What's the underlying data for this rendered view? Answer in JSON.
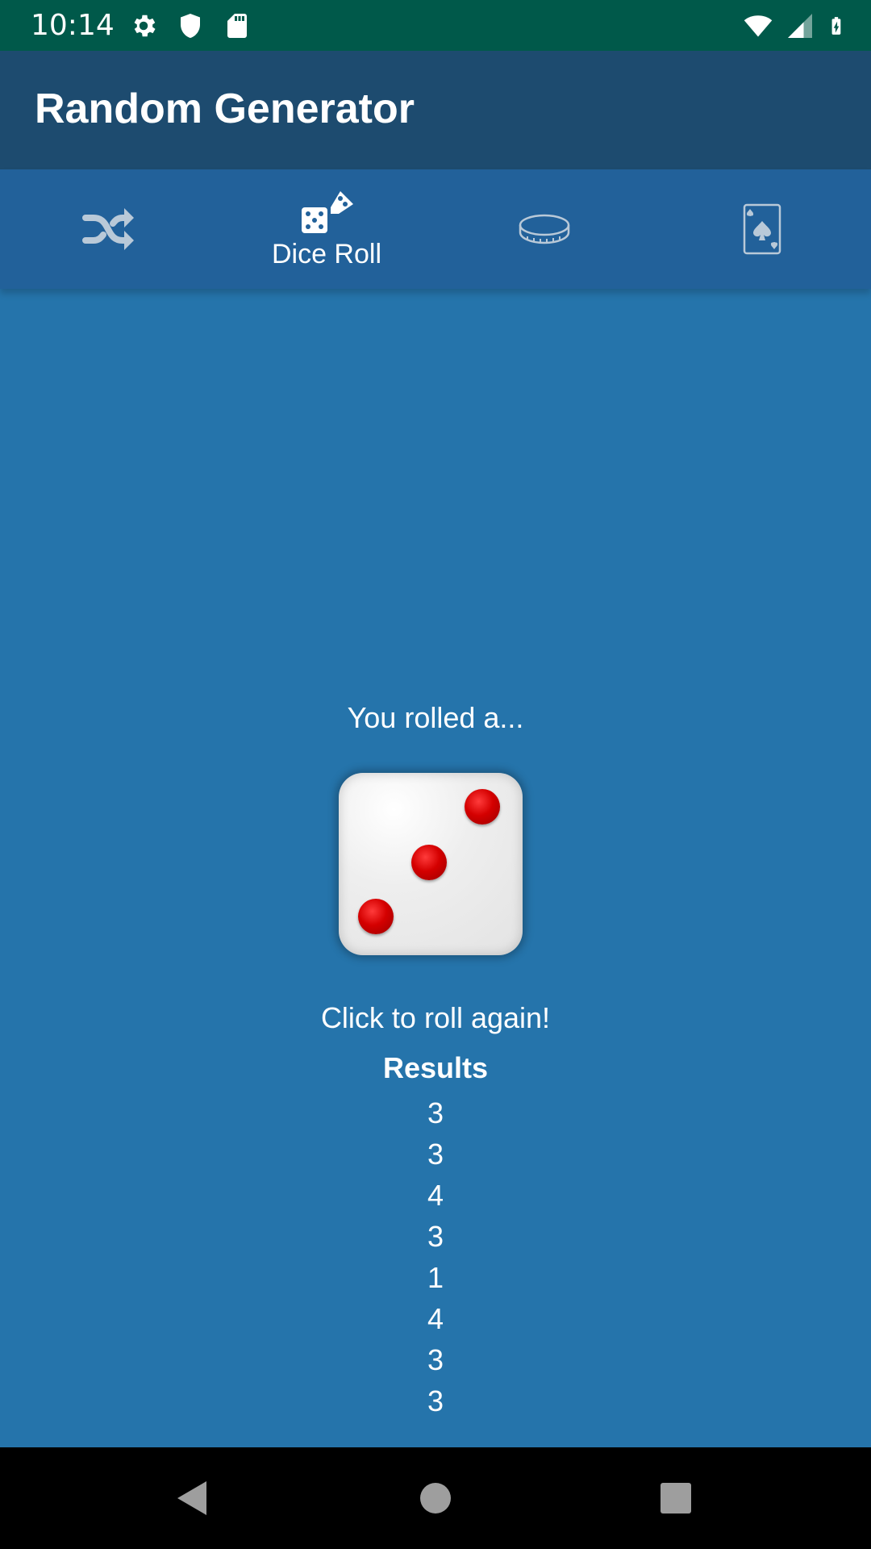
{
  "status_bar": {
    "time": "10:14",
    "left_icons": [
      "gear-icon",
      "shield-icon",
      "sd-card-icon"
    ],
    "right_icons": [
      "wifi-icon",
      "cell-signal-icon",
      "battery-charging-icon"
    ]
  },
  "app_bar": {
    "title": "Random Generator",
    "color": "#1d4b6f"
  },
  "tabs": [
    {
      "icon": "shuffle-icon",
      "label": "",
      "selected": false
    },
    {
      "icon": "dice-icon",
      "label": "Dice Roll",
      "selected": true
    },
    {
      "icon": "coin-icon",
      "label": "",
      "selected": false
    },
    {
      "icon": "playing-card-icon",
      "label": "",
      "selected": false
    }
  ],
  "main": {
    "rolled_text": "You rolled a...",
    "die_value": 3,
    "roll_again_text": "Click to roll again!",
    "results_title": "Results",
    "results": [
      "3",
      "3",
      "4",
      "3",
      "1",
      "4",
      "3",
      "3"
    ],
    "background": "#2574ab"
  },
  "nav_bar": {
    "buttons": [
      "back-icon",
      "home-icon",
      "recents-icon"
    ]
  }
}
